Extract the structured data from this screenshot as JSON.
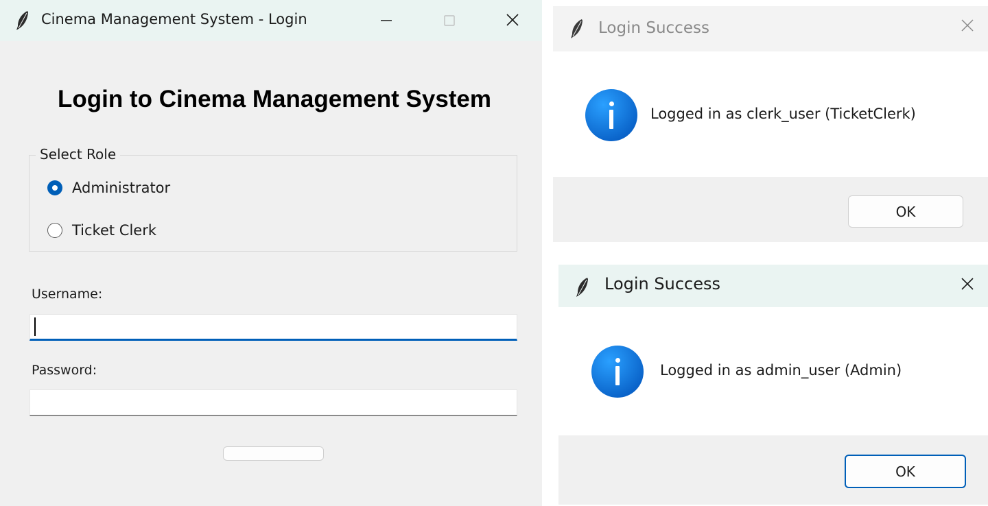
{
  "login_window": {
    "title": "Cinema Management System - Login",
    "heading": "Login to Cinema Management System",
    "role_group": {
      "label": "Select Role",
      "options": [
        {
          "label": "Administrator",
          "selected": true
        },
        {
          "label": "Ticket Clerk",
          "selected": false
        }
      ]
    },
    "username": {
      "label": "Username:",
      "value": ""
    },
    "password": {
      "label": "Password:",
      "value": ""
    },
    "login_button_label": ""
  },
  "message_boxes": [
    {
      "title": "Login Success",
      "message": "Logged in as clerk_user (TicketClerk)",
      "ok_label": "OK"
    },
    {
      "title": "Login Success",
      "message": "Logged in as admin_user (Admin)",
      "ok_label": "OK"
    }
  ],
  "colors": {
    "accent": "#005fb8",
    "titlebar_active": "#eaf4f2",
    "dialog_bg": "#f0f0f0"
  }
}
